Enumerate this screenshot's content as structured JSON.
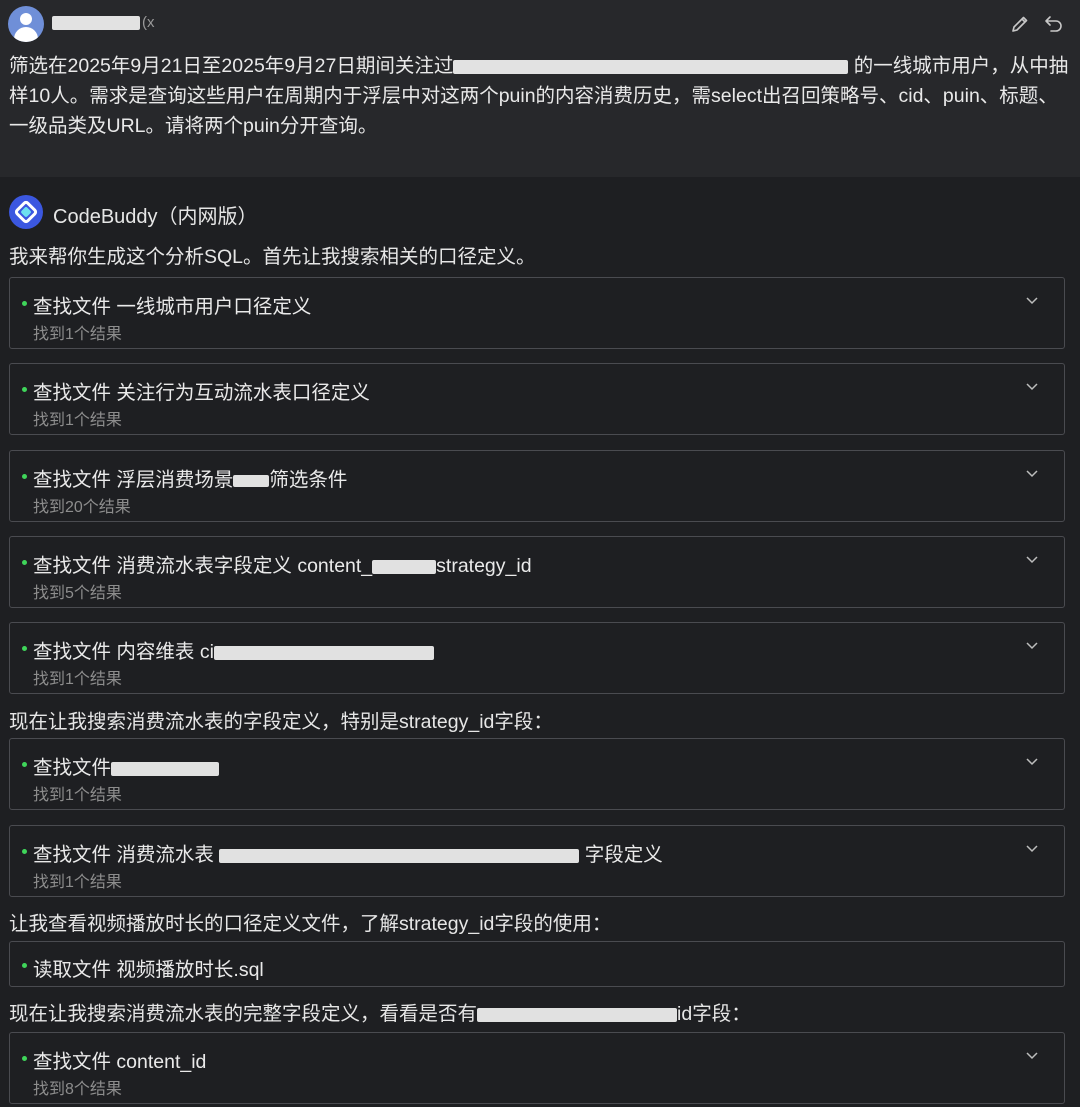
{
  "user": {
    "name_suffix": "(x",
    "message": {
      "part1": "筛选在2025年9月21日至2025年9月27日期间关注过",
      "part2": " 的一线城市用户，从中抽样10人。需求是查询这些用户在周期内于浮层中对这两个puin的内容消费历史，需select出召回策略号、cid、puin、标题、一级品类及URL。请将两个puin分开查询。"
    }
  },
  "assistant": {
    "name": "CodeBuddy（内网版）",
    "intro": "我来帮你生成这个分析SQL。首先让我搜索相关的口径定义。"
  },
  "cards": {
    "c1": {
      "title": "查找文件 一线城市用户口径定义",
      "result": "找到1个结果"
    },
    "c2": {
      "title": "查找文件 关注行为互动流水表口径定义",
      "result": "找到1个结果"
    },
    "c3": {
      "title_a": "查找文件 浮层消费场景",
      "title_b": "筛选条件",
      "result": "找到20个结果"
    },
    "c4": {
      "title_a": "查找文件 消费流水表字段定义 content_",
      "title_b": "strategy_id",
      "result": "找到5个结果"
    },
    "c5": {
      "title_a": "查找文件 内容维表 ci",
      "result": "找到1个结果"
    },
    "c6": {
      "title_a": "查找文件",
      "result": "找到1个结果"
    },
    "c7": {
      "title_a": "查找文件 消费流水表 ",
      "title_b": " 字段定义",
      "result": "找到1个结果"
    },
    "c8": {
      "title": "读取文件 视频播放时长.sql"
    },
    "c9": {
      "title": "查找文件 content_id",
      "result": "找到8个结果"
    }
  },
  "messages": {
    "m2": "现在让我搜索消费流水表的字段定义，特别是strategy_id字段：",
    "m3": "让我查看视频播放时长的口径定义文件，了解strategy_id字段的使用：",
    "m4_a": "现在让我搜索消费流水表的完整字段定义，看看是否有",
    "m4_b": "id字段："
  }
}
